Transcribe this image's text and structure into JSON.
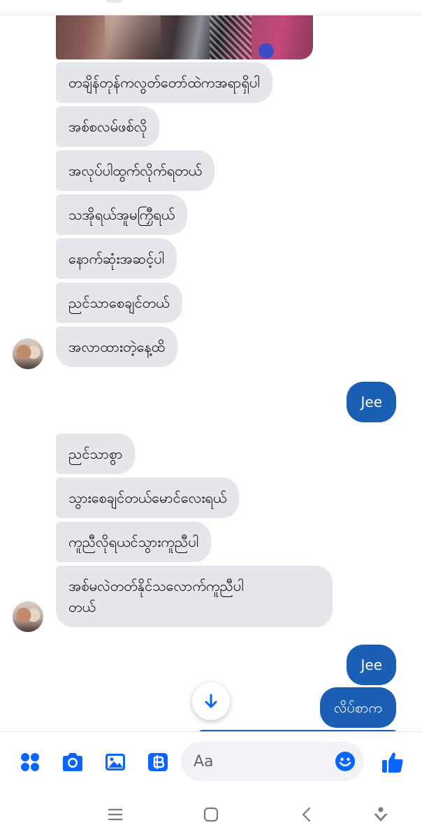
{
  "chat": {
    "incoming_group_1": [
      "တချိန်တုန်ကလွတ်တော်ထဲကအရာရှိပါ",
      "အစ်စလမ်ဖစ်လို",
      "အလုပ်ပါထွက်လိုက်ရတယ်",
      "သအိုရယ်အူမကြှီရယ်",
      "နောက်ဆုံးအဆင့်ပါ",
      "ညင်သာစေချင်တယ်",
      "အလာထားတဲ့နေ့ထိ"
    ],
    "outgoing_1": "Jee",
    "incoming_group_2": [
      "ညင်သာစွာ",
      "သွားစေချင်တယ်မောင်လေးရယ်",
      "ကူညီလိုရယင်သွားကူညီပါ",
      "အစ်မလဲတတ်နိုင်သလောက်ကူညီပါ",
      "တယ်"
    ],
    "outgoing_2": "Jee",
    "outgoing_3": "လိပ်စာက"
  },
  "composer": {
    "placeholder": "Aa"
  },
  "colors": {
    "accent": "#0866ff",
    "outgoing_bubble": "#1a5fb4",
    "incoming_bubble": "#e4e6eb"
  },
  "icons": {
    "apps": "apps-grid-icon",
    "camera": "camera-icon",
    "gallery": "gallery-icon",
    "gif": "gif-sticker-icon",
    "emoji": "emoji-icon",
    "like": "thumbs-up-icon",
    "scroll": "arrow-down-icon",
    "nav_recent": "recent-apps-icon",
    "nav_home": "home-icon",
    "nav_back": "back-icon",
    "nav_assist": "assist-icon"
  }
}
